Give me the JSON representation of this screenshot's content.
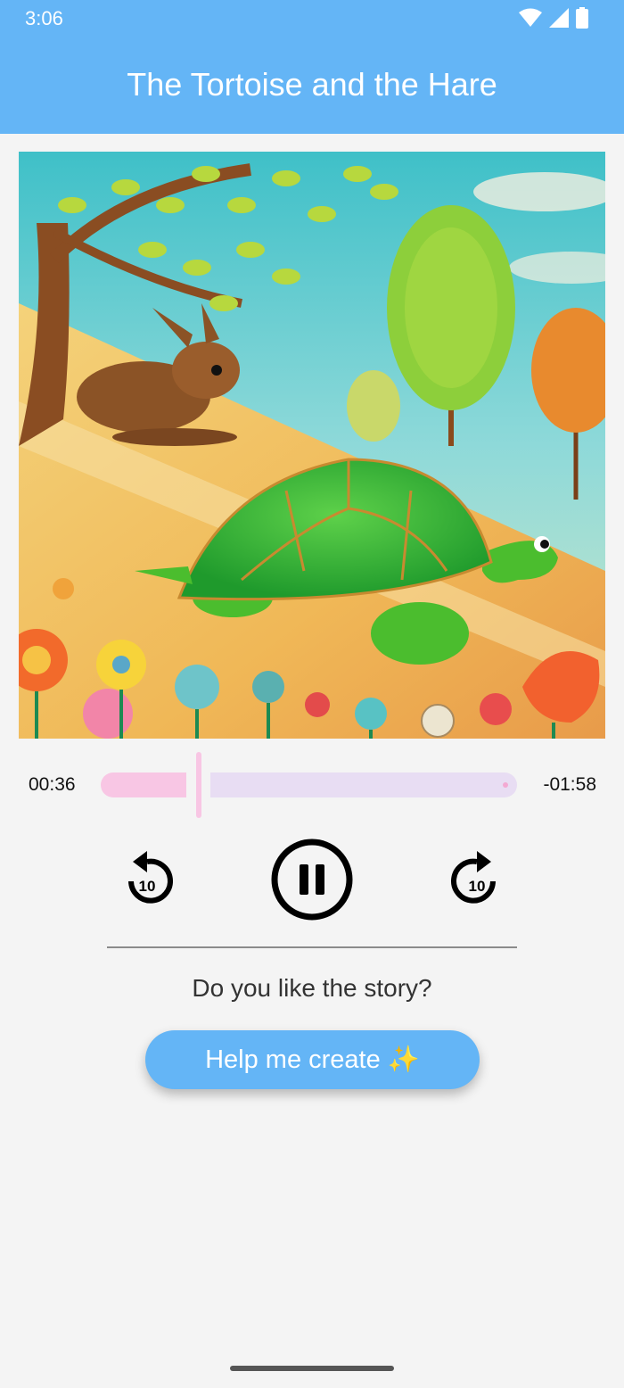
{
  "status_bar": {
    "time": "3:06",
    "icons": [
      "wifi-icon",
      "signal-icon",
      "battery-icon"
    ]
  },
  "header": {
    "title": "The Tortoise and the Hare"
  },
  "player": {
    "elapsed": "00:36",
    "remaining": "-01:58",
    "progress": 0.23,
    "skip_back_seconds": "10",
    "skip_forward_seconds": "10",
    "state": "playing"
  },
  "feedback": {
    "question": "Do you like the story?",
    "create_button": "Help me create ✨"
  },
  "colors": {
    "accent": "#64b5f6",
    "seek_played": "#f8c6e4",
    "seek_rest": "#e8ddf3",
    "background": "#f4f4f4"
  }
}
